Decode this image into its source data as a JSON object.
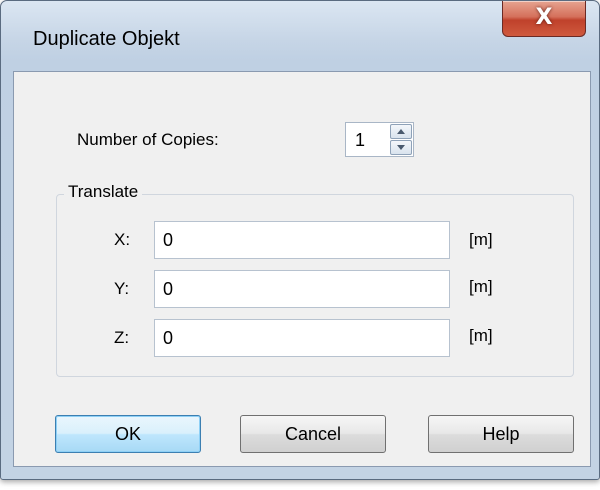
{
  "window": {
    "title": "Duplicate Objekt",
    "close_label": "X"
  },
  "copies": {
    "label": "Number of Copies:",
    "value": "1"
  },
  "translate": {
    "group_label": "Translate",
    "x_label": "X:",
    "x_value": "0",
    "x_unit": "[m]",
    "y_label": "Y:",
    "y_value": "0",
    "y_unit": "[m]",
    "z_label": "Z:",
    "z_value": "0",
    "z_unit": "[m]"
  },
  "buttons": {
    "ok": "OK",
    "cancel": "Cancel",
    "help": "Help"
  },
  "icons": {
    "close": "close-icon",
    "spin_up": "chevron-up-icon",
    "spin_down": "chevron-down-icon"
  },
  "colors": {
    "close_button": "#c8503a",
    "default_button_border": "#3c7fb1",
    "client_background": "#f0f0f0"
  }
}
